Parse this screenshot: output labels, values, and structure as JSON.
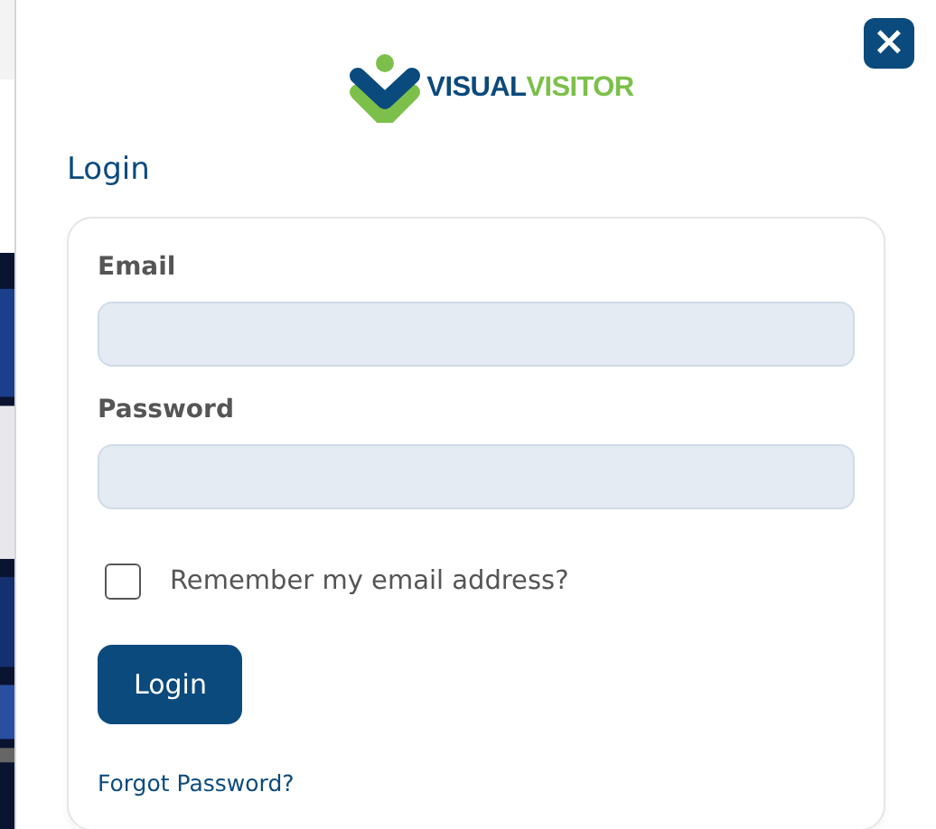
{
  "logo": {
    "parts": [
      {
        "text": "VISUAL",
        "color": "#0b4a7d"
      },
      {
        "text": "VISITOR",
        "color": "#7cc04b"
      }
    ]
  },
  "close_button": {
    "label": "×"
  },
  "heading": "Login",
  "fields": [
    {
      "label": "Email"
    },
    {
      "label": "Password"
    }
  ],
  "remember": {
    "label": "Remember my email address?",
    "checked": false
  },
  "submit_button": "Login",
  "forgot_link": "Forgot Password?"
}
